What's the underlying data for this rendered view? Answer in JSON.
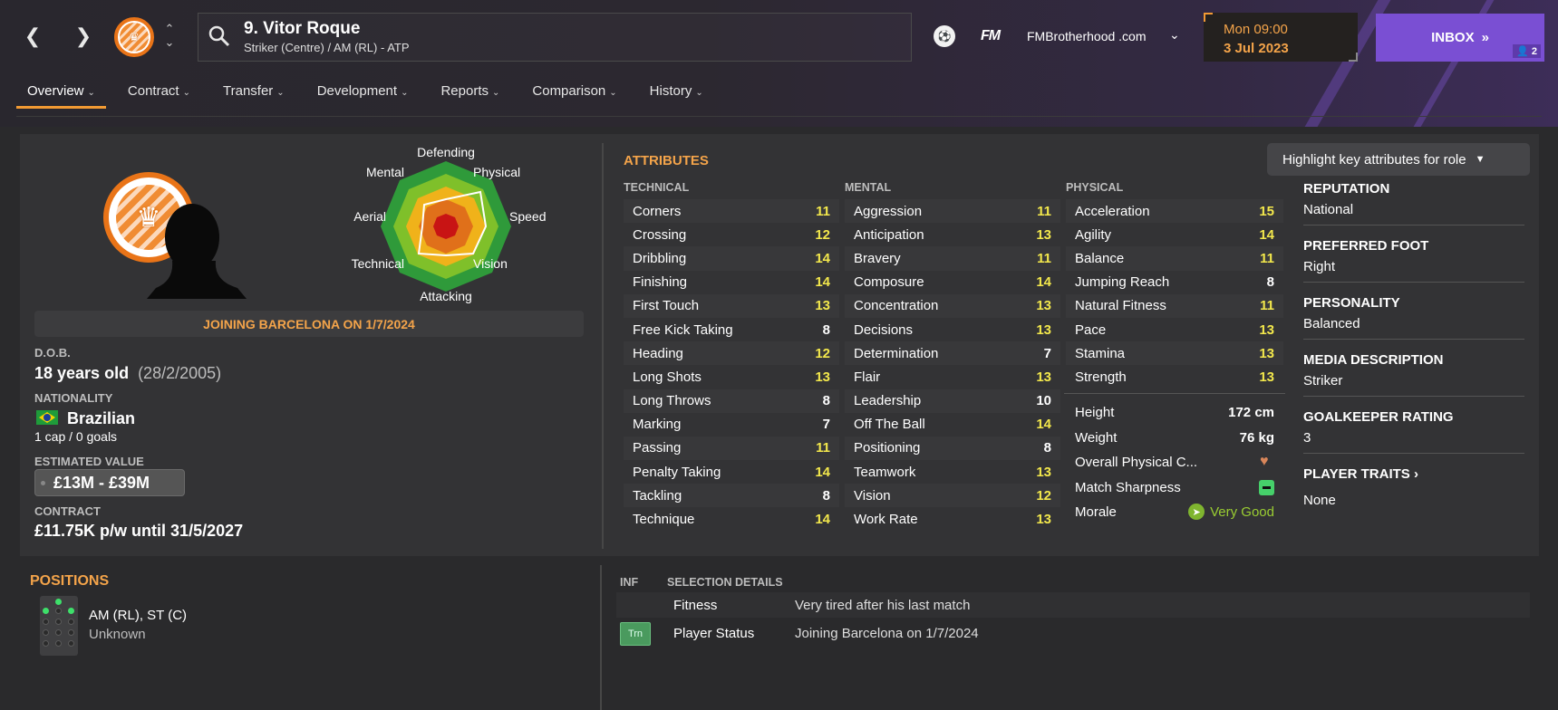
{
  "header": {
    "player_title": "9. Vitor Roque",
    "player_subtitle": "Striker (Centre) / AM (RL) - ATP",
    "site_name": "FMBrotherhood .com",
    "fm_logo": "FM",
    "date_day": "Mon 09:00",
    "date_date": "3 Jul 2023",
    "inbox_label": "INBOX",
    "inbox_count": "2"
  },
  "tabs": [
    {
      "label": "Overview"
    },
    {
      "label": "Contract"
    },
    {
      "label": "Transfer"
    },
    {
      "label": "Development"
    },
    {
      "label": "Reports"
    },
    {
      "label": "Comparison"
    },
    {
      "label": "History"
    }
  ],
  "radar": {
    "labels": {
      "defending": "Defending",
      "physical": "Physical",
      "speed": "Speed",
      "vision": "Vision",
      "attacking": "Attacking",
      "technical": "Technical",
      "aerial": "Aerial",
      "mental": "Mental"
    }
  },
  "profile": {
    "joining_banner": "JOINING BARCELONA ON 1/7/2024",
    "dob_label": "D.O.B.",
    "dob_age": "18 years old",
    "dob_date": "(28/2/2005)",
    "nationality_label": "NATIONALITY",
    "nationality": "Brazilian",
    "caps": "1 cap / 0 goals",
    "value_label": "ESTIMATED VALUE",
    "value": "£13M - £39M",
    "contract_label": "CONTRACT",
    "contract": "£11.75K p/w until 31/5/2027"
  },
  "attributes": {
    "title": "ATTRIBUTES",
    "highlight_button": "Highlight key attributes for role",
    "technical_header": "TECHNICAL",
    "mental_header": "MENTAL",
    "physical_header": "PHYSICAL",
    "technical": [
      {
        "name": "Corners",
        "value": "11"
      },
      {
        "name": "Crossing",
        "value": "12"
      },
      {
        "name": "Dribbling",
        "value": "14"
      },
      {
        "name": "Finishing",
        "value": "14"
      },
      {
        "name": "First Touch",
        "value": "13"
      },
      {
        "name": "Free Kick Taking",
        "value": "8"
      },
      {
        "name": "Heading",
        "value": "12"
      },
      {
        "name": "Long Shots",
        "value": "13"
      },
      {
        "name": "Long Throws",
        "value": "8"
      },
      {
        "name": "Marking",
        "value": "7"
      },
      {
        "name": "Passing",
        "value": "11"
      },
      {
        "name": "Penalty Taking",
        "value": "14"
      },
      {
        "name": "Tackling",
        "value": "8"
      },
      {
        "name": "Technique",
        "value": "14"
      }
    ],
    "mental": [
      {
        "name": "Aggression",
        "value": "11"
      },
      {
        "name": "Anticipation",
        "value": "13"
      },
      {
        "name": "Bravery",
        "value": "11"
      },
      {
        "name": "Composure",
        "value": "14"
      },
      {
        "name": "Concentration",
        "value": "13"
      },
      {
        "name": "Decisions",
        "value": "13"
      },
      {
        "name": "Determination",
        "value": "7"
      },
      {
        "name": "Flair",
        "value": "13"
      },
      {
        "name": "Leadership",
        "value": "10"
      },
      {
        "name": "Off The Ball",
        "value": "14"
      },
      {
        "name": "Positioning",
        "value": "8"
      },
      {
        "name": "Teamwork",
        "value": "13"
      },
      {
        "name": "Vision",
        "value": "12"
      },
      {
        "name": "Work Rate",
        "value": "13"
      }
    ],
    "physical": [
      {
        "name": "Acceleration",
        "value": "15"
      },
      {
        "name": "Agility",
        "value": "14"
      },
      {
        "name": "Balance",
        "value": "11"
      },
      {
        "name": "Jumping Reach",
        "value": "8"
      },
      {
        "name": "Natural Fitness",
        "value": "11"
      },
      {
        "name": "Pace",
        "value": "13"
      },
      {
        "name": "Stamina",
        "value": "13"
      },
      {
        "name": "Strength",
        "value": "13"
      }
    ],
    "height_label": "Height",
    "height": "172 cm",
    "weight_label": "Weight",
    "weight": "76 kg",
    "physical_condition_label": "Overall Physical C...",
    "sharpness_label": "Match Sharpness",
    "morale_label": "Morale",
    "morale": "Very Good"
  },
  "info": {
    "reputation_label": "REPUTATION",
    "reputation": "National",
    "foot_label": "PREFERRED FOOT",
    "foot": "Right",
    "personality_label": "PERSONALITY",
    "personality": "Balanced",
    "media_label": "MEDIA DESCRIPTION",
    "media": "Striker",
    "gk_label": "GOALKEEPER RATING",
    "gk": "3",
    "traits_label": "PLAYER TRAITS",
    "traits": "None"
  },
  "positions": {
    "title": "POSITIONS",
    "value": "AM (RL), ST (C)",
    "familiarity": "Unknown"
  },
  "selection": {
    "inf_header": "INF",
    "details_header": "SELECTION DETAILS",
    "rows": [
      {
        "key": "Fitness",
        "value": "Very tired after his last match"
      },
      {
        "key": "Player Status",
        "value": "Joining Barcelona on 1/7/2024"
      }
    ],
    "trn_badge": "Trn"
  },
  "colors": {
    "accent": "#f4a44a",
    "inbox": "#7a4fd3",
    "attr_high": "#f3e84c",
    "morale": "#9acd32"
  }
}
